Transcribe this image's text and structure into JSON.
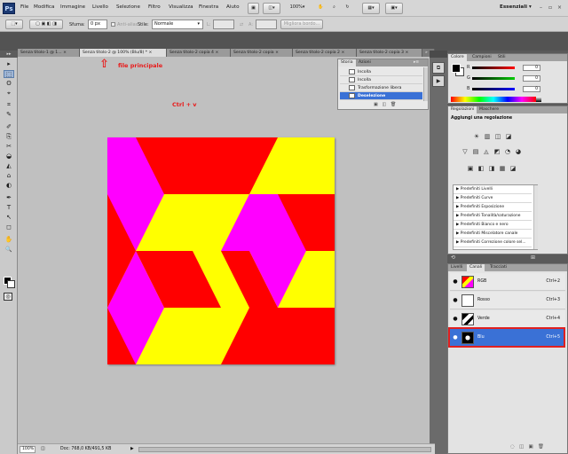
{
  "app": {
    "logo": "Ps",
    "workspace": "Essenziali",
    "workspace_arrow": "▾"
  },
  "menu": [
    "File",
    "Modifica",
    "Immagine",
    "Livello",
    "Selezione",
    "Filtro",
    "Visualizza",
    "Finestra",
    "Aiuto"
  ],
  "menubar_controls": {
    "zoom": "100%",
    "zoom_arrow": "▾",
    "minimize": "–",
    "restore": "▫",
    "close": "×"
  },
  "options_bar": {
    "sfuma_label": "Sfuma:",
    "sfuma_value": "0 px",
    "antialias_label": "Anti-alias",
    "stile_label": "Stile:",
    "stile_value": "Normale",
    "l_label": "L:",
    "a_label": "A:",
    "refine_edge": "Migliora bordo..."
  },
  "tabs": [
    {
      "label": "Senza titolo-1 @ 1...",
      "close": "×",
      "active": false
    },
    {
      "label": "Senza titolo-2 @ 100% (Blu/8) *",
      "close": "×",
      "active": true
    },
    {
      "label": "Senza titolo-2 copia 4",
      "close": "×",
      "active": false
    },
    {
      "label": "Senza titolo-2 copia",
      "close": "×",
      "active": false
    },
    {
      "label": "Senza titolo-2 copia 2",
      "close": "×",
      "active": false
    },
    {
      "label": "Senza titolo-2 copia 3",
      "close": "×",
      "active": false
    }
  ],
  "tab_overflow": "»",
  "annotations": {
    "file_label": "file principale",
    "arrow": "⇧",
    "shortcut": "Ctrl + v"
  },
  "history_panel": {
    "tabs": [
      "Storia",
      "Azioni"
    ],
    "items": [
      {
        "label": "Incolla",
        "selected": false
      },
      {
        "label": "Incolla",
        "selected": false
      },
      {
        "label": "Trasformazione libera",
        "selected": false
      },
      {
        "label": "Deselezione",
        "selected": true
      }
    ]
  },
  "color_panel": {
    "tabs": [
      "Colore",
      "Campioni",
      "Stili"
    ],
    "sliders": [
      {
        "label": "R",
        "value": "0",
        "color": "#ff0000"
      },
      {
        "label": "G",
        "value": "0",
        "color": "#00cc00"
      },
      {
        "label": "B",
        "value": "0",
        "color": "#0000ff"
      }
    ]
  },
  "adjustments_panel": {
    "tabs": [
      "Regolazioni",
      "Maschere"
    ],
    "title": "Aggiungi una regolazione",
    "icons_row1": [
      "☀",
      "▥",
      "◫",
      "◪"
    ],
    "icons_row2": [
      "▽",
      "▤",
      "◬",
      "◩",
      "◔",
      "◕"
    ],
    "icons_row3": [
      "▣",
      "◧",
      "◨",
      "▦",
      "◪"
    ],
    "presets": [
      "Predefiniti Livelli",
      "Predefiniti Curve",
      "Predefiniti Esposizione",
      "Predefiniti Tonalità/saturazione",
      "Predefiniti Bianco e nero",
      "Predefiniti Miscelatore canale",
      "Predefiniti Correzione colore sel..."
    ]
  },
  "channels_panel": {
    "tabs": [
      "Livelli",
      "Canali",
      "Tracciati"
    ],
    "eye": "●",
    "channels": [
      {
        "name": "RGB",
        "shortcut": "Ctrl+2",
        "selected": false
      },
      {
        "name": "Rosso",
        "shortcut": "Ctrl+3",
        "selected": false
      },
      {
        "name": "Verde",
        "shortcut": "Ctrl+4",
        "selected": false
      },
      {
        "name": "Blu",
        "shortcut": "Ctrl+5",
        "selected": true
      }
    ]
  },
  "status_bar": {
    "zoom": "100%",
    "doc_info": "Doc: 768,0 KB/491,5 KB",
    "arrow": "▶"
  },
  "tools": [
    "▸",
    "⬚",
    "ʘ",
    "⌖",
    "⌗",
    "✎",
    "✐",
    "⎘",
    "✂",
    "◒",
    "◭",
    "⌂",
    "◐",
    "✒",
    "T",
    "↖",
    "◻",
    "✋",
    "🔍"
  ],
  "colors": {
    "red": "#ff0000",
    "yellow": "#ffff00",
    "magenta": "#ff00ff",
    "selection": "#3a71d6",
    "annotation": "#e81a1a"
  }
}
